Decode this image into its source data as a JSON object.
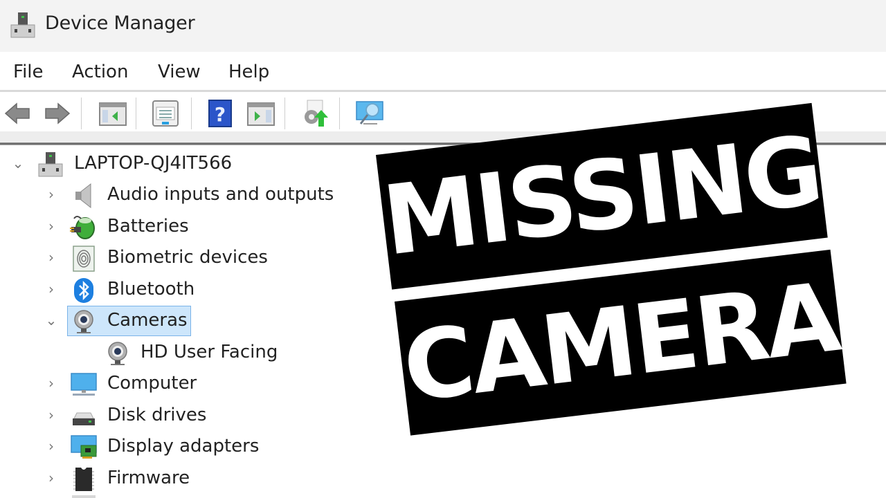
{
  "window": {
    "title": "Device Manager",
    "app_icon": "device-manager-icon"
  },
  "menu": {
    "items": [
      "File",
      "Action",
      "View",
      "Help"
    ]
  },
  "toolbar": {
    "buttons": [
      {
        "name": "back",
        "icon": "back-arrow-icon"
      },
      {
        "name": "forward",
        "icon": "forward-arrow-icon"
      },
      {
        "name": "show-hide-console-tree",
        "icon": "console-tree-icon"
      },
      {
        "name": "properties",
        "icon": "properties-icon"
      },
      {
        "name": "help",
        "icon": "help-icon",
        "glyph": "?"
      },
      {
        "name": "show-hide-action-pane",
        "icon": "action-pane-icon"
      },
      {
        "name": "update-driver",
        "icon": "update-driver-icon"
      },
      {
        "name": "scan-hardware-changes",
        "icon": "scan-hardware-icon"
      }
    ]
  },
  "tree": {
    "root": {
      "label": "LAPTOP-QJ4IT566",
      "expanded": true,
      "icon": "computer-root-icon"
    },
    "items": [
      {
        "label": "Audio inputs and outputs",
        "icon": "speaker-icon",
        "expanded": false
      },
      {
        "label": "Batteries",
        "icon": "battery-icon",
        "expanded": false
      },
      {
        "label": "Biometric devices",
        "icon": "fingerprint-icon",
        "expanded": false
      },
      {
        "label": "Bluetooth",
        "icon": "bluetooth-icon",
        "expanded": false
      },
      {
        "label": "Cameras",
        "icon": "webcam-icon",
        "expanded": true,
        "selected": true,
        "children": [
          {
            "label": "HD User Facing",
            "icon": "webcam-icon"
          }
        ]
      },
      {
        "label": "Computer",
        "icon": "monitor-icon",
        "expanded": false
      },
      {
        "label": "Disk drives",
        "icon": "disk-drive-icon",
        "expanded": false
      },
      {
        "label": "Display adapters",
        "icon": "display-adapter-icon",
        "expanded": false
      },
      {
        "label": "Firmware",
        "icon": "firmware-chip-icon",
        "expanded": false
      }
    ]
  },
  "overlay": {
    "line1": "MISSING",
    "line2": "CAMERA"
  },
  "colors": {
    "selection_bg": "#cde6fb",
    "selection_border": "#7ab3e8",
    "banner_bg": "#000000",
    "banner_text": "#ffffff",
    "help_blue": "#2b55c9",
    "bluetooth_blue": "#1d7fe0"
  }
}
